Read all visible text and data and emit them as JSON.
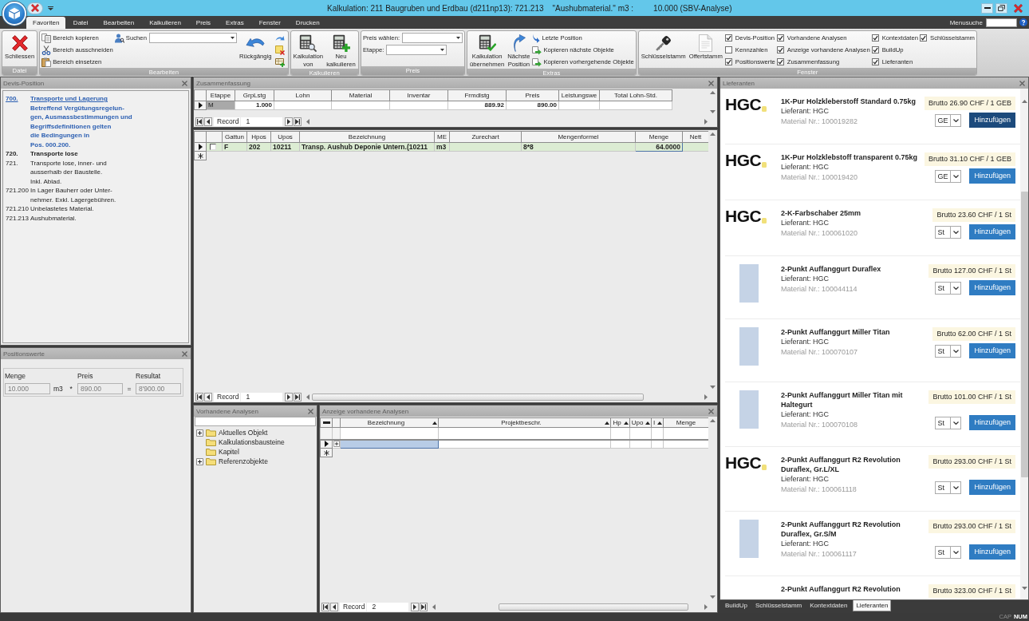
{
  "window": {
    "title_parts": [
      "Kalkulation: 211 Baugruben und Erdbau (d211np13): 721.213",
      "\"Aushubmaterial.\" m3 :",
      "10.000 (SBV-Analyse)"
    ]
  },
  "ribbon_tabs": [
    {
      "label": "Favoriten",
      "selected": true
    },
    {
      "label": "Datei",
      "selected": false
    },
    {
      "label": "Bearbeiten",
      "selected": false
    },
    {
      "label": "Kalkulieren",
      "selected": false
    },
    {
      "label": "Preis",
      "selected": false
    },
    {
      "label": "Extras",
      "selected": false
    },
    {
      "label": "Fenster",
      "selected": false
    },
    {
      "label": "Drucken",
      "selected": false
    }
  ],
  "menu_search": {
    "label": "Menusuche"
  },
  "ribbon_groups": [
    {
      "label": "Datei",
      "columns": [
        [
          {
            "kind": "large",
            "label": "Schliessen"
          }
        ]
      ]
    },
    {
      "label": "Bearbeiten",
      "columns": [
        [
          {
            "kind": "small",
            "label": "Bereich kopieren"
          },
          {
            "kind": "small",
            "label": "Bereich ausschneiden"
          },
          {
            "kind": "small",
            "label": "Bereich einsetzen"
          }
        ],
        [
          {
            "kind": "search",
            "label": "Suchen"
          }
        ],
        [
          {
            "kind": "large",
            "label": "Rückgängig"
          }
        ],
        [
          {
            "kind": "icon"
          },
          {
            "kind": "icon"
          },
          {
            "kind": "icon"
          }
        ]
      ]
    },
    {
      "label": "Kalkulieren",
      "columns": [
        [
          {
            "kind": "large",
            "label": "Kalkulation von"
          }
        ],
        [
          {
            "kind": "large",
            "label": "Neu kalkulieren"
          }
        ]
      ]
    },
    {
      "label": "Preis",
      "columns": [
        [
          {
            "kind": "combo",
            "label": "Preis wählen:"
          },
          {
            "kind": "combo",
            "label": "Etappe:"
          }
        ]
      ]
    },
    {
      "label": "Extras",
      "columns": [
        [
          {
            "kind": "large",
            "label": "Kalkulation übernehmen"
          }
        ],
        [
          {
            "kind": "large",
            "label": "Nächste Position"
          }
        ],
        [
          {
            "kind": "small",
            "label": "Letzte Position"
          },
          {
            "kind": "small",
            "label": "Kopieren nächste Objekte"
          },
          {
            "kind": "small",
            "label": "Kopieren vorhergehende Objekte"
          }
        ]
      ]
    },
    {
      "label": "Fenster",
      "columns": [
        [
          {
            "kind": "large",
            "label": "Schlüsselstamm"
          }
        ],
        [
          {
            "kind": "large",
            "label": "Offertstamm"
          }
        ],
        [
          {
            "kind": "check",
            "label": "Devis-Position",
            "checked": true
          },
          {
            "kind": "check",
            "label": "Kennzahlen",
            "checked": false
          },
          {
            "kind": "check",
            "label": "Positionswerte",
            "checked": true
          }
        ],
        [
          {
            "kind": "check",
            "label": "Vorhandene Analysen",
            "checked": true
          },
          {
            "kind": "check",
            "label": "Anzeige vorhandene Analysen",
            "checked": true
          },
          {
            "kind": "check",
            "label": "Zusammenfassung",
            "checked": true
          }
        ],
        [
          {
            "kind": "check",
            "label": "Kontextdaten",
            "checked": true
          },
          {
            "kind": "check",
            "label": "BuildUp",
            "checked": true
          },
          {
            "kind": "check",
            "label": "Lieferanten",
            "checked": true
          }
        ],
        [
          {
            "kind": "check",
            "label": "Schlüsselstamm",
            "checked": true
          }
        ]
      ]
    }
  ],
  "devis": {
    "title": "Devis-Position",
    "entries": [
      {
        "kind": "link",
        "number": "700.",
        "title": "Transporte und Lagerung",
        "text": "Betreffend Vergütungsregelun-\ngen, Ausmassbestimmungen und\nBegriffsdefinitionen gelten\ndie Bedingungen in\nPos. 000.200."
      },
      {
        "kind": "heading",
        "number": "720.",
        "text": "Transporte lose"
      },
      {
        "kind": "plain",
        "number": "721.",
        "text": "Transporte lose, inner- und\nausserhalb der Baustelle.\nInkl. Ablad."
      },
      {
        "kind": "plain",
        "number": "721.200",
        "text": "In Lager Bauherr oder Unter-\nnehmer. Exkl. Lagergebühren."
      },
      {
        "kind": "plain",
        "number": "721.210",
        "text": "Unbelastetes Material."
      },
      {
        "kind": "plain",
        "number": "721.213",
        "text": "Aushubmaterial."
      }
    ]
  },
  "position_values": {
    "title": "Positionswerte",
    "fields": [
      {
        "label": "Menge",
        "value": "10.000",
        "unit": "m3",
        "disabled": true
      },
      {
        "operator": "*",
        "label": "Preis",
        "value": "890.00",
        "disabled": true
      },
      {
        "operator": "=",
        "label": "Resultat",
        "value": "8'900.00",
        "disabled": true
      }
    ]
  },
  "summary": {
    "title": "Zusammenfassung",
    "columns": [
      "Etappe",
      "GrpLstg",
      "Lohn",
      "Material",
      "Inventar",
      "Frmdlstg",
      "Preis",
      "Leistungswe",
      "Total Lohn-Std."
    ],
    "rows": [
      {
        "current": true,
        "cells": [
          "M",
          "1.000",
          null,
          null,
          null,
          "889.92",
          "890.00",
          null,
          null
        ]
      }
    ],
    "record": {
      "label": "Record",
      "value": "1"
    }
  },
  "positions_grid": {
    "columns": [
      "Gattun",
      "Hpos",
      "Upos",
      "Bezeichnung",
      "ME",
      "Zurechart",
      "Mengenformel",
      "Menge",
      "Nett"
    ],
    "rows": [
      {
        "current": true,
        "checked": false,
        "cells": [
          {
            "text": "F",
            "selected": false
          },
          {
            "text": "202",
            "selected": false
          },
          {
            "text": "10211",
            "selected": false
          },
          {
            "text": "Transp. Aushub Deponie Untern.(10211",
            "selected": false
          },
          {
            "text": "m3",
            "selected": false
          },
          {
            "selected": false
          },
          {
            "text": "8*8",
            "selected": false
          },
          {
            "text": "64.0000",
            "selected": true
          },
          {
            "selected": false
          }
        ]
      }
    ],
    "record": {
      "label": "Record",
      "value": "1"
    }
  },
  "analyses_tree": {
    "title": "Vorhandene Analysen",
    "items": [
      {
        "label": "Aktuelles Objekt",
        "expandable": true
      },
      {
        "label": "Kalkulationsbausteine",
        "expandable": false
      },
      {
        "label": "Kapitel",
        "expandable": false
      },
      {
        "label": "Referenzobjekte",
        "expandable": true
      }
    ]
  },
  "analyses_grid": {
    "title": "Anzeige vorhandene Analysen",
    "columns": [
      {
        "label": "Bezeichnung",
        "sorted": true
      },
      {
        "label": "Projektbeschr.",
        "sorted": true
      },
      {
        "label": "Hp",
        "sorted": true
      },
      {
        "label": "Upo",
        "sorted": true
      },
      {
        "label": "I",
        "sorted": true
      },
      {
        "label": "Menge",
        "sorted": false
      }
    ],
    "rows": [
      {
        "current": true,
        "selected": true
      }
    ],
    "record": {
      "label": "Record",
      "value": "2"
    }
  },
  "suppliers": {
    "title": "Lieferanten",
    "items": [
      {
        "image": {
          "kind": "logo",
          "text": "HGC"
        },
        "name": "1K-Pur Holzkleberstoff Standard 0.75kg",
        "supplier": "Lieferant: HGC",
        "material": "Material Nr.: 100019282",
        "price": "Brutto 26.90 CHF / 1 GEB",
        "unit": "GE",
        "button": "Hinzufügen",
        "active": true
      },
      {
        "image": {
          "kind": "logo",
          "text": "HGC"
        },
        "name": "1K-Pur Holzklebstoff transparent 0.75kg",
        "supplier": "Lieferant: HGC",
        "material": "Material Nr.: 100019420",
        "price": "Brutto 31.10 CHF / 1 GEB",
        "unit": "GE",
        "button": "Hinzufügen",
        "active": false
      },
      {
        "image": {
          "kind": "logo",
          "text": "HGC"
        },
        "name": "2-K-Farbschaber 25mm",
        "supplier": "Lieferant: HGC",
        "material": "Material Nr.: 100061020",
        "price": "Brutto 23.60 CHF / 1 St",
        "unit": "St",
        "button": "Hinzufügen",
        "active": false
      },
      {
        "image": {
          "kind": "photo"
        },
        "name": "2-Punkt Auffanggurt Duraflex",
        "supplier": "Lieferant: HGC",
        "material": "Material Nr.: 100044114",
        "price": "Brutto 127.00 CHF / 1 St",
        "unit": "St",
        "button": "Hinzufügen",
        "active": false
      },
      {
        "image": {
          "kind": "photo"
        },
        "name": "2-Punkt Auffanggurt Miller Titan",
        "supplier": "Lieferant: HGC",
        "material": "Material Nr.: 100070107",
        "price": "Brutto 62.00 CHF / 1 St",
        "unit": "St",
        "button": "Hinzufügen",
        "active": false
      },
      {
        "image": {
          "kind": "photo"
        },
        "name": "2-Punkt Auffanggurt Miller Titan mit Haltegurt",
        "supplier": "Lieferant: HGC",
        "material": "Material Nr.: 100070108",
        "price": "Brutto 101.00 CHF / 1 St",
        "unit": "St",
        "button": "Hinzufügen",
        "active": false
      },
      {
        "image": {
          "kind": "logo",
          "text": "HGC"
        },
        "name": "2-Punkt Auffanggurt R2 Revolution Duraflex, Gr.L/XL",
        "supplier": "Lieferant: HGC",
        "material": "Material Nr.: 100061118",
        "price": "Brutto 293.00 CHF / 1 St",
        "unit": "St",
        "button": "Hinzufügen",
        "active": false
      },
      {
        "image": {
          "kind": "photo"
        },
        "name": "2-Punkt Auffanggurt R2 Revolution Duraflex, Gr.S/M",
        "supplier": "Lieferant: HGC",
        "material": "Material Nr.: 100061117",
        "price": "Brutto 293.00 CHF / 1 St",
        "unit": "St",
        "button": "Hinzufügen",
        "active": false
      },
      {
        "name": "2-Punkt Auffanggurt R2 Revolution",
        "price": "Brutto 323.00 CHF / 1 St"
      }
    ]
  },
  "bottom_tabs": [
    {
      "label": "BuildUp",
      "selected": false
    },
    {
      "label": "Schlüsselstamm",
      "selected": false
    },
    {
      "label": "Kontextdaten",
      "selected": false
    },
    {
      "label": "Lieferanten",
      "selected": true
    }
  ],
  "status_bar": {
    "indicators": [
      {
        "label": "CAP",
        "on": false
      },
      {
        "label": "NUM",
        "on": true
      }
    ]
  }
}
